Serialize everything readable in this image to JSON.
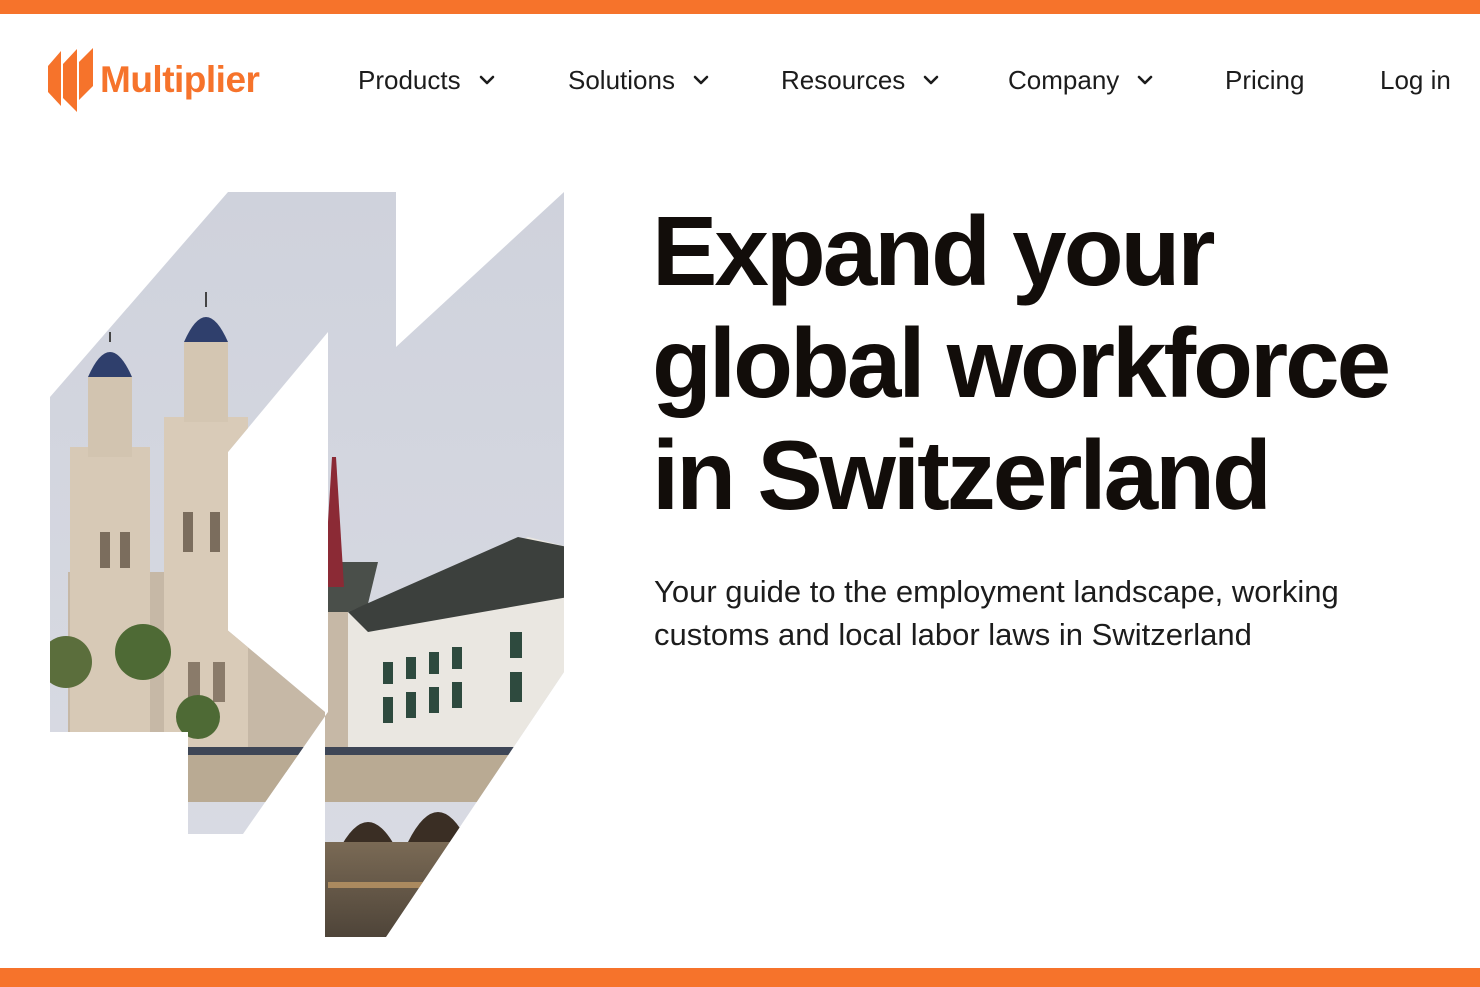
{
  "brand": {
    "name": "Multiplier",
    "color": "#f6732b",
    "logo_icon": "multiplier-stripes-icon"
  },
  "nav": {
    "products": "Products",
    "solutions": "Solutions",
    "resources": "Resources",
    "company": "Company",
    "pricing": "Pricing",
    "login": "Log in",
    "dropdown_icon": "chevron-down-icon"
  },
  "hero": {
    "headline_line1": "Expand your",
    "headline_line2": "global workforce",
    "headline_line3": "in Switzerland",
    "subtitle_line1": "Your guide to the employment landscape, working",
    "subtitle_line2": "customs and local labor laws in Switzerland",
    "image_subject": "Zurich Grossmünster church towers and river bridge at dusk"
  },
  "colors": {
    "accent": "#f6732b",
    "text": "#120d0a",
    "background": "#ffffff"
  }
}
